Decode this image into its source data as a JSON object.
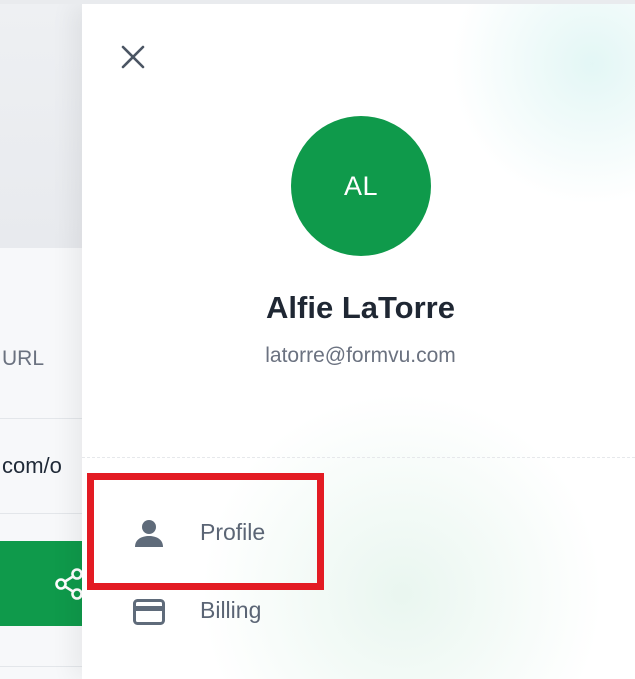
{
  "background_app": {
    "url_label": "URL",
    "url_value": "com/o",
    "share_icon": "share-icon",
    "accent_color": "#0f9a4b"
  },
  "drawer": {
    "close_icon": "close-icon",
    "avatar": {
      "initials": "AL",
      "color": "#0f9a4b"
    },
    "user": {
      "name": "Alfie LaTorre",
      "email": "latorre@formvu.com"
    },
    "menu": {
      "items": [
        {
          "label": "Profile",
          "icon": "person-icon"
        },
        {
          "label": "Billing",
          "icon": "credit-card-icon"
        }
      ]
    }
  },
  "annotation": {
    "highlight_color": "#e31b23",
    "target": "Profile"
  }
}
